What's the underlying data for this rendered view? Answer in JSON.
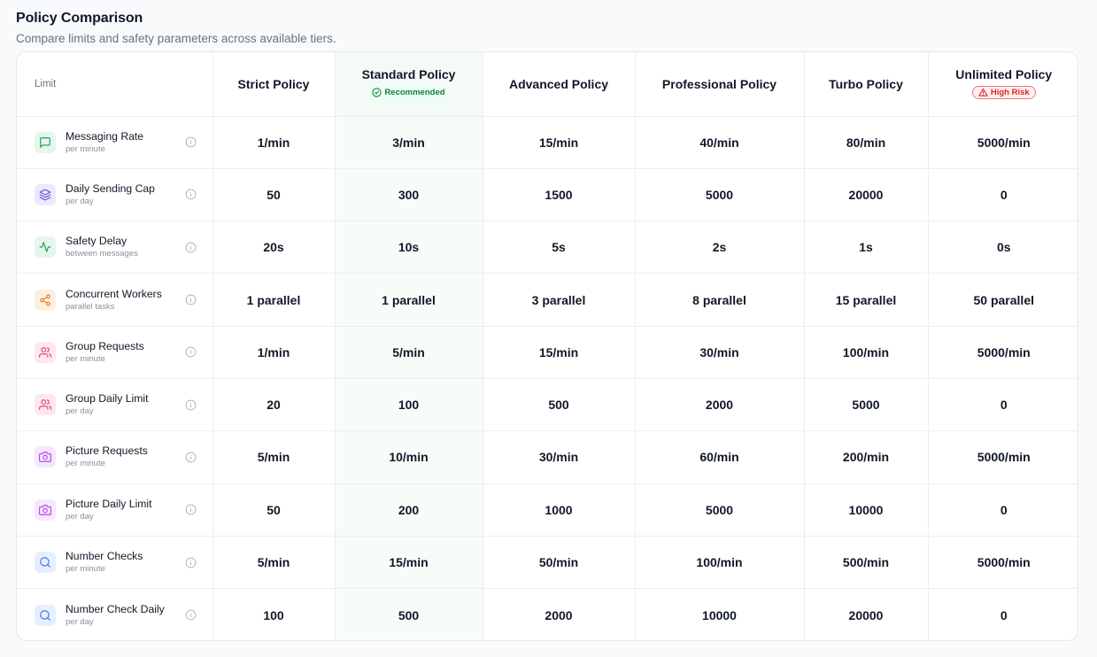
{
  "header": {
    "title": "Policy Comparison",
    "subtitle": "Compare limits and safety parameters across available tiers."
  },
  "table": {
    "limit_header": "Limit",
    "policies": [
      {
        "name": "Strict Policy",
        "badge": null
      },
      {
        "name": "Standard Policy",
        "badge": "Recommended"
      },
      {
        "name": "Advanced Policy",
        "badge": null
      },
      {
        "name": "Professional Policy",
        "badge": null
      },
      {
        "name": "Turbo Policy",
        "badge": null
      },
      {
        "name": "Unlimited Policy",
        "badge": "High Risk"
      }
    ],
    "rows": [
      {
        "name": "Messaging Rate",
        "sub": "per minute",
        "icon": "message-square-icon",
        "values": [
          "1/min",
          "3/min",
          "15/min",
          "40/min",
          "80/min",
          "5000/min"
        ]
      },
      {
        "name": "Daily Sending Cap",
        "sub": "per day",
        "icon": "layers-icon",
        "values": [
          "50",
          "300",
          "1500",
          "5000",
          "20000",
          "0"
        ]
      },
      {
        "name": "Safety Delay",
        "sub": "between messages",
        "icon": "activity-icon",
        "values": [
          "20s",
          "10s",
          "5s",
          "2s",
          "1s",
          "0s"
        ]
      },
      {
        "name": "Concurrent Workers",
        "sub": "parallel tasks",
        "icon": "share-nodes-icon",
        "values": [
          "1 parallel",
          "1 parallel",
          "3 parallel",
          "8 parallel",
          "15 parallel",
          "50 parallel"
        ]
      },
      {
        "name": "Group Requests",
        "sub": "per minute",
        "icon": "users-icon",
        "values": [
          "1/min",
          "5/min",
          "15/min",
          "30/min",
          "100/min",
          "5000/min"
        ]
      },
      {
        "name": "Group Daily Limit",
        "sub": "per day",
        "icon": "users-icon",
        "values": [
          "20",
          "100",
          "500",
          "2000",
          "5000",
          "0"
        ]
      },
      {
        "name": "Picture Requests",
        "sub": "per minute",
        "icon": "camera-icon",
        "values": [
          "5/min",
          "10/min",
          "30/min",
          "60/min",
          "200/min",
          "5000/min"
        ]
      },
      {
        "name": "Picture Daily Limit",
        "sub": "per day",
        "icon": "camera-icon",
        "values": [
          "50",
          "200",
          "1000",
          "5000",
          "10000",
          "0"
        ]
      },
      {
        "name": "Number Checks",
        "sub": "per minute",
        "icon": "search-icon",
        "values": [
          "5/min",
          "15/min",
          "50/min",
          "100/min",
          "500/min",
          "5000/min"
        ]
      },
      {
        "name": "Number Check Daily",
        "sub": "per day",
        "icon": "search-icon",
        "values": [
          "100",
          "500",
          "2000",
          "10000",
          "20000",
          "0"
        ]
      }
    ]
  },
  "colors": {
    "recommended": "#15803d",
    "high_risk": "#dc2626",
    "recommended_column_bg": "#f7fcf9"
  }
}
